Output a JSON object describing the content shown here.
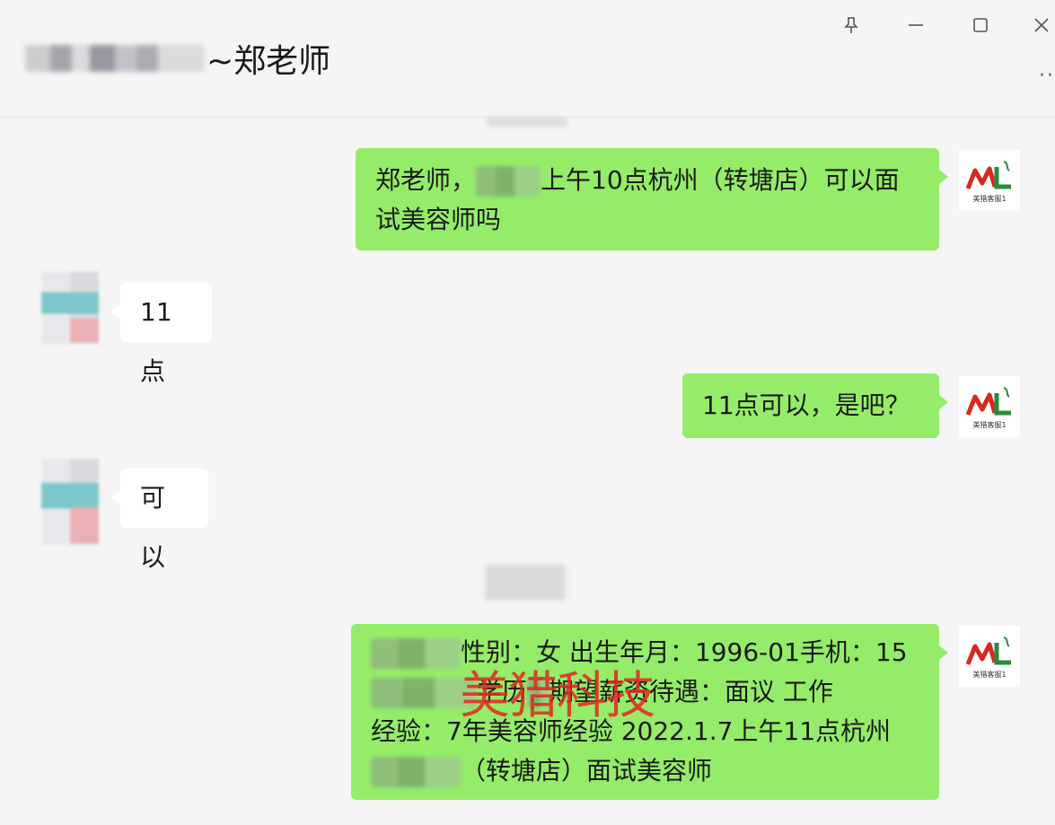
{
  "window": {
    "title": "~郑老师",
    "controls": {
      "pin_icon": "pin-icon",
      "minimize": "—",
      "maximize": "☐",
      "close": "✕"
    },
    "more_label": "··"
  },
  "messages": [
    {
      "from": "me",
      "text_before": "郑老师，",
      "text_after": "上午10点杭州（转塘店）可以面",
      "text_line2": "试美容师吗"
    },
    {
      "from": "other",
      "text": "11点"
    },
    {
      "from": "me",
      "text": "11点可以，是吧？"
    },
    {
      "from": "other",
      "text": "可以"
    },
    {
      "from": "me",
      "line1": "性别：女 出生年月：1996-01手机：15",
      "line2_a": "学历",
      "line2_b": "期望薪资待遇：面议 工作",
      "line3": "经验：7年美容师经验 2022.1.7上午11点杭州",
      "line4": "（转塘店）面试美容师"
    }
  ],
  "avatar_me": {
    "brand_text": "美猎客服1",
    "logo": "ML"
  },
  "watermark": "美猎科技",
  "colors": {
    "bubble_out": "#95ec69",
    "bubble_in": "#ffffff",
    "watermark": "#e4261f"
  }
}
